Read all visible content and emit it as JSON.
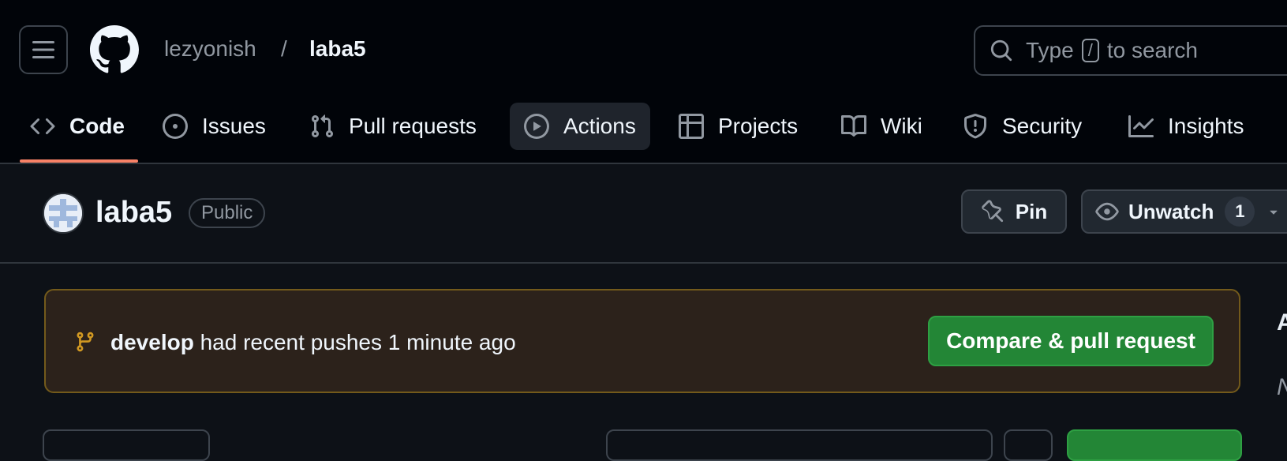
{
  "header": {
    "owner": "lezyonish",
    "separator": "/",
    "repo": "laba5",
    "search": {
      "prefix": "Type",
      "key": "/",
      "suffix": "to search"
    }
  },
  "tabs": [
    {
      "label": "Code",
      "icon": "code-icon",
      "active": true
    },
    {
      "label": "Issues",
      "icon": "issue-opened-icon"
    },
    {
      "label": "Pull requests",
      "icon": "git-pull-request-icon"
    },
    {
      "label": "Actions",
      "icon": "play-icon"
    },
    {
      "label": "Projects",
      "icon": "table-icon"
    },
    {
      "label": "Wiki",
      "icon": "book-icon"
    },
    {
      "label": "Security",
      "icon": "shield-icon"
    },
    {
      "label": "Insights",
      "icon": "graph-icon"
    }
  ],
  "repo_header": {
    "name": "laba5",
    "visibility": "Public",
    "pin_label": "Pin",
    "unwatch_label": "Unwatch",
    "watch_count": "1"
  },
  "banner": {
    "branch": "develop",
    "message": "had recent pushes 1 minute ago",
    "button_label": "Compare & pull request"
  },
  "colors": {
    "background": "#0d1117",
    "header_bg": "#010409",
    "tab_underline": "#f78166",
    "banner_bg": "#2c221b",
    "primary_button": "#238636"
  }
}
